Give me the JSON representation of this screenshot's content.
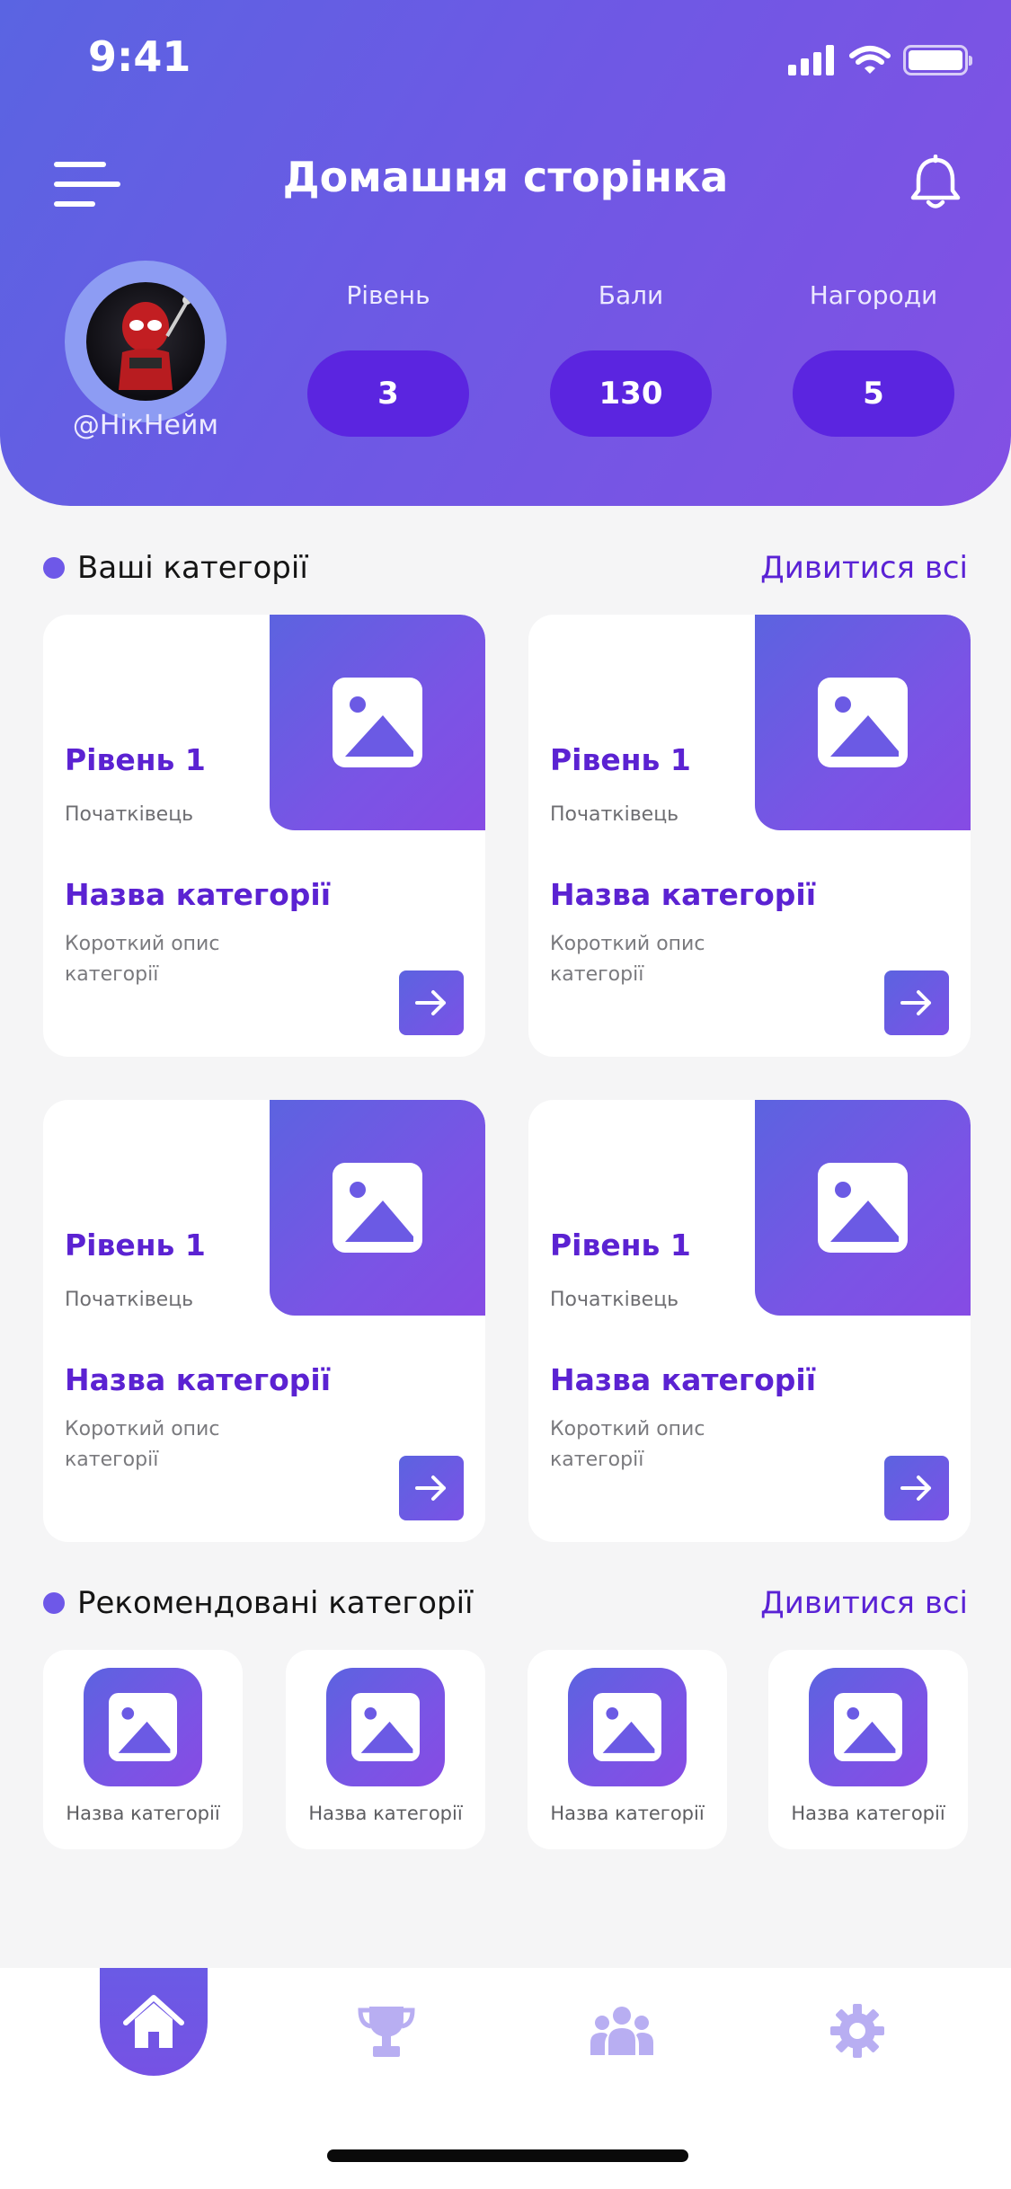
{
  "status_bar": {
    "time": "9:41"
  },
  "header": {
    "title": "Домашня сторінка",
    "nickname": "@НікНейм",
    "stats": [
      {
        "label": "Рівень",
        "value": "3"
      },
      {
        "label": "Бали",
        "value": "130"
      },
      {
        "label": "Нагороди",
        "value": "5"
      }
    ]
  },
  "your_categories": {
    "title": "Ваші категорії",
    "see_all": "Дивитися всі",
    "cards": [
      {
        "level": "Рівень 1",
        "rank": "Початківець",
        "name": "Назва категорії",
        "description": "Короткий опис категорії"
      },
      {
        "level": "Рівень 1",
        "rank": "Початківець",
        "name": "Назва категорії",
        "description": "Короткий опис категорії"
      },
      {
        "level": "Рівень 1",
        "rank": "Початківець",
        "name": "Назва категорії",
        "description": "Короткий опис категорії"
      },
      {
        "level": "Рівень 1",
        "rank": "Початківець",
        "name": "Назва категорії",
        "description": "Короткий опис категорії"
      }
    ]
  },
  "recommended": {
    "title": "Рекомендовані категорії",
    "see_all": "Дивитися всі",
    "items": [
      {
        "name": "Назва категорії"
      },
      {
        "name": "Назва категорії"
      },
      {
        "name": "Назва категорії"
      },
      {
        "name": "Назва категорії"
      }
    ]
  },
  "bottom_nav": {
    "active": "home",
    "items": [
      "home-icon",
      "trophy-icon",
      "people-icon",
      "gear-icon"
    ]
  },
  "colors": {
    "header_gradient_start": "#5a64e2",
    "header_gradient_end": "#8350e4",
    "pill": "#5b25e0",
    "accent_text": "#5b22d2",
    "nav_inactive": "#b8aef2"
  }
}
